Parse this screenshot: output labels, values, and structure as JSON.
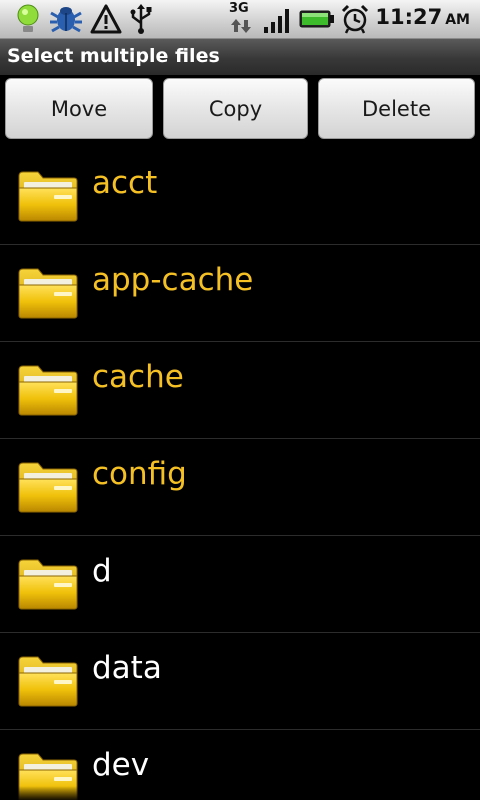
{
  "status_bar": {
    "time": "11:27",
    "ampm": "AM",
    "network_label": "3G",
    "icons": [
      "notification-light-icon",
      "bug-icon",
      "warning-icon",
      "usb-icon",
      "network-3g-icon",
      "signal-icon",
      "battery-icon",
      "alarm-icon"
    ],
    "colors": {
      "light": "#8fdc3a",
      "bug": "#2a5fb0",
      "battery": "#3dbb2b"
    }
  },
  "title_bar": {
    "title": "Select multiple files"
  },
  "actions": {
    "move_label": "Move",
    "copy_label": "Copy",
    "delete_label": "Delete"
  },
  "files": [
    {
      "name": "acct",
      "color": "#f5c024"
    },
    {
      "name": "app-cache",
      "color": "#f5c024"
    },
    {
      "name": "cache",
      "color": "#f5c024"
    },
    {
      "name": "config",
      "color": "#f5c024"
    },
    {
      "name": "d",
      "color": "#ffffff"
    },
    {
      "name": "data",
      "color": "#ffffff"
    },
    {
      "name": "dev",
      "color": "#ffffff"
    }
  ],
  "colors": {
    "background": "#000000",
    "selected_text": "#f5c024",
    "normal_text": "#ffffff",
    "folder": "#f0c10b"
  }
}
